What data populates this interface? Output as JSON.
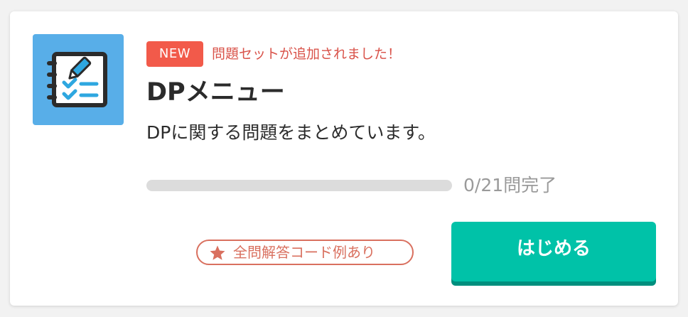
{
  "card": {
    "icon": "checklist-notebook-icon",
    "badge": "NEW",
    "notice": "問題セットが追加されました！",
    "title": "DPメニュー",
    "description": "DPに関する問題をまとめています。",
    "progress": {
      "completed": 0,
      "total": 21,
      "fraction": 0,
      "label": "0/21問完了"
    },
    "code_tag": {
      "icon": "star-icon",
      "label": "全問解答コード例あり"
    },
    "start_button_label": "はじめる"
  },
  "colors": {
    "icon_tile": "#58aee8",
    "badge": "#f25a4a",
    "notice_text": "#d9534a",
    "accent": "#00c2a8",
    "accent_shadow": "#008f7e",
    "tag": "#d9705f",
    "track": "#dcdcdc"
  }
}
